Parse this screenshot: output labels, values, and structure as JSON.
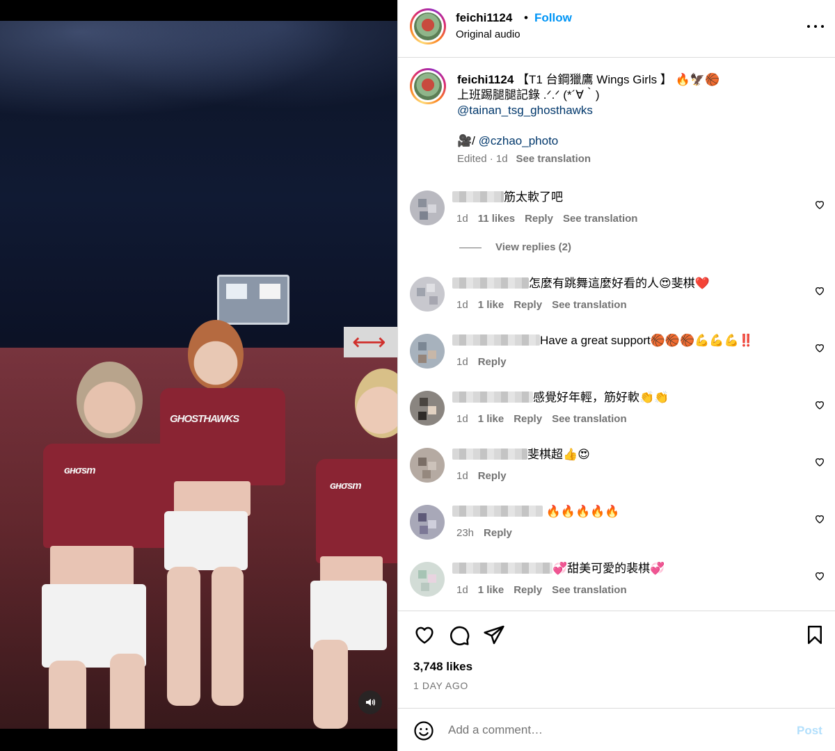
{
  "video": {
    "sound_icon": "speaker-icon"
  },
  "header": {
    "username": "feichi1124",
    "separator": "•",
    "follow_label": "Follow",
    "audio": "Original audio",
    "more_icon": "more-horizontal-icon"
  },
  "caption": {
    "username": "feichi1124",
    "line1": " 【T1 台鋼獵鷹 Wings Girls 】 🔥🦅🏀",
    "line2": "上班踢腿腿記錄 .ᐟ.ᐟ (*´∀｀)",
    "mention1": "@tainan_tsg_ghosthawks",
    "camera": "🎥/ ",
    "mention2": "@czhao_photo",
    "meta": "Edited · 1d",
    "see_translation": "See translation"
  },
  "comments": [
    {
      "text": "筋太軟了吧",
      "time": "1d",
      "likes": "11 likes",
      "reply": "Reply",
      "translate": "See translation"
    },
    {
      "text": "怎麼有跳舞這麼好看的人😍斐棋❤️",
      "time": "1d",
      "likes": "1 like",
      "reply": "Reply",
      "translate": "See translation"
    },
    {
      "text": "Have a great support🏀🏀🏀💪💪💪‼️",
      "time": "1d",
      "reply": "Reply"
    },
    {
      "text": "感覺好年輕，筋好軟👏👏",
      "time": "1d",
      "likes": "1 like",
      "reply": "Reply",
      "translate": "See translation"
    },
    {
      "text": "斐棋超👍😍",
      "time": "1d",
      "reply": "Reply"
    },
    {
      "text": " 🔥🔥🔥🔥🔥",
      "time": "23h",
      "reply": "Reply"
    },
    {
      "text": "💞甜美可愛的裴棋💞",
      "time": "1d",
      "likes": "1 like",
      "reply": "Reply",
      "translate": "See translation"
    }
  ],
  "view_replies": "View replies (2)",
  "footer": {
    "likes": "3,748 likes",
    "ago": "1 DAY AGO",
    "comment_placeholder": "Add a comment…",
    "post_label": "Post"
  },
  "colors": {
    "link_blue": "#0095f6",
    "mention_blue": "#00376b",
    "muted": "#737373",
    "post_disabled": "#b2dffc"
  }
}
